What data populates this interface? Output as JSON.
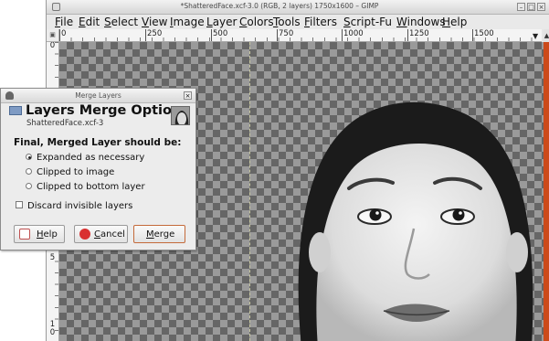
{
  "window": {
    "title": "*ShatteredFace.xcf-3.0 (RGB, 2 layers) 1750x1600 – GIMP",
    "controls": [
      "–",
      "□",
      "×"
    ]
  },
  "menubar": [
    "File",
    "Edit",
    "Select",
    "View",
    "Image",
    "Layer",
    "Colors",
    "Tools",
    "Filters",
    "Script-Fu",
    "Windows",
    "Help"
  ],
  "rulers": {
    "horizontal": [
      "0",
      "250",
      "500",
      "750",
      "1000",
      "1250",
      "1500"
    ],
    "vertical": [
      "0",
      "5",
      "1",
      "0"
    ]
  },
  "dialog": {
    "window_title": "Merge Layers",
    "heading": "Layers Merge Options",
    "subheading": "ShatteredFace.xcf-3",
    "section_label": "Final, Merged Layer should be:",
    "options": [
      {
        "label": "Expanded as necessary",
        "selected": true
      },
      {
        "label": "Clipped to image",
        "selected": false
      },
      {
        "label": "Clipped to bottom layer",
        "selected": false
      }
    ],
    "checkbox": {
      "label": "Discard invisible layers",
      "checked": false
    },
    "buttons": {
      "help": "Help",
      "cancel": "Cancel",
      "merge": "Merge"
    }
  },
  "icons": {
    "window": "gimp-window-icon",
    "dialog": "merge-layers-icon",
    "help": "help-icon",
    "cancel": "cancel-icon"
  },
  "colors": {
    "accent": "#cc4a1a",
    "merge_button_border": "#c46a3a"
  }
}
